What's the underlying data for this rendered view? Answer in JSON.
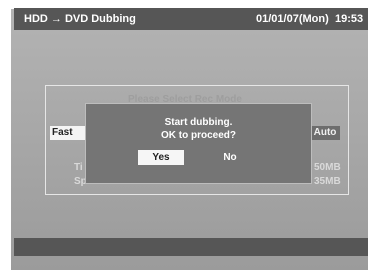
{
  "header": {
    "title": "HDD → DVD Dubbing",
    "date": "01/01/07(Mon)",
    "time": "19:53"
  },
  "rec_mode_panel": {
    "title_partial": "Please Select Rec Mode",
    "mode_left": "Fast",
    "mode_right": "Auto",
    "row1_label": "Ti",
    "row1_value": "50MB",
    "row2_label": "Sp",
    "row2_value": "35MB"
  },
  "dialog": {
    "line1": "Start dubbing.",
    "line2": "OK to proceed?",
    "yes_label": "Yes",
    "no_label": "No",
    "selected": "Yes"
  },
  "colors": {
    "screen_bg": "#a8a8a8",
    "bar_bg": "#565656",
    "dialog_bg": "#757575",
    "highlight": "#f6f6f6"
  }
}
